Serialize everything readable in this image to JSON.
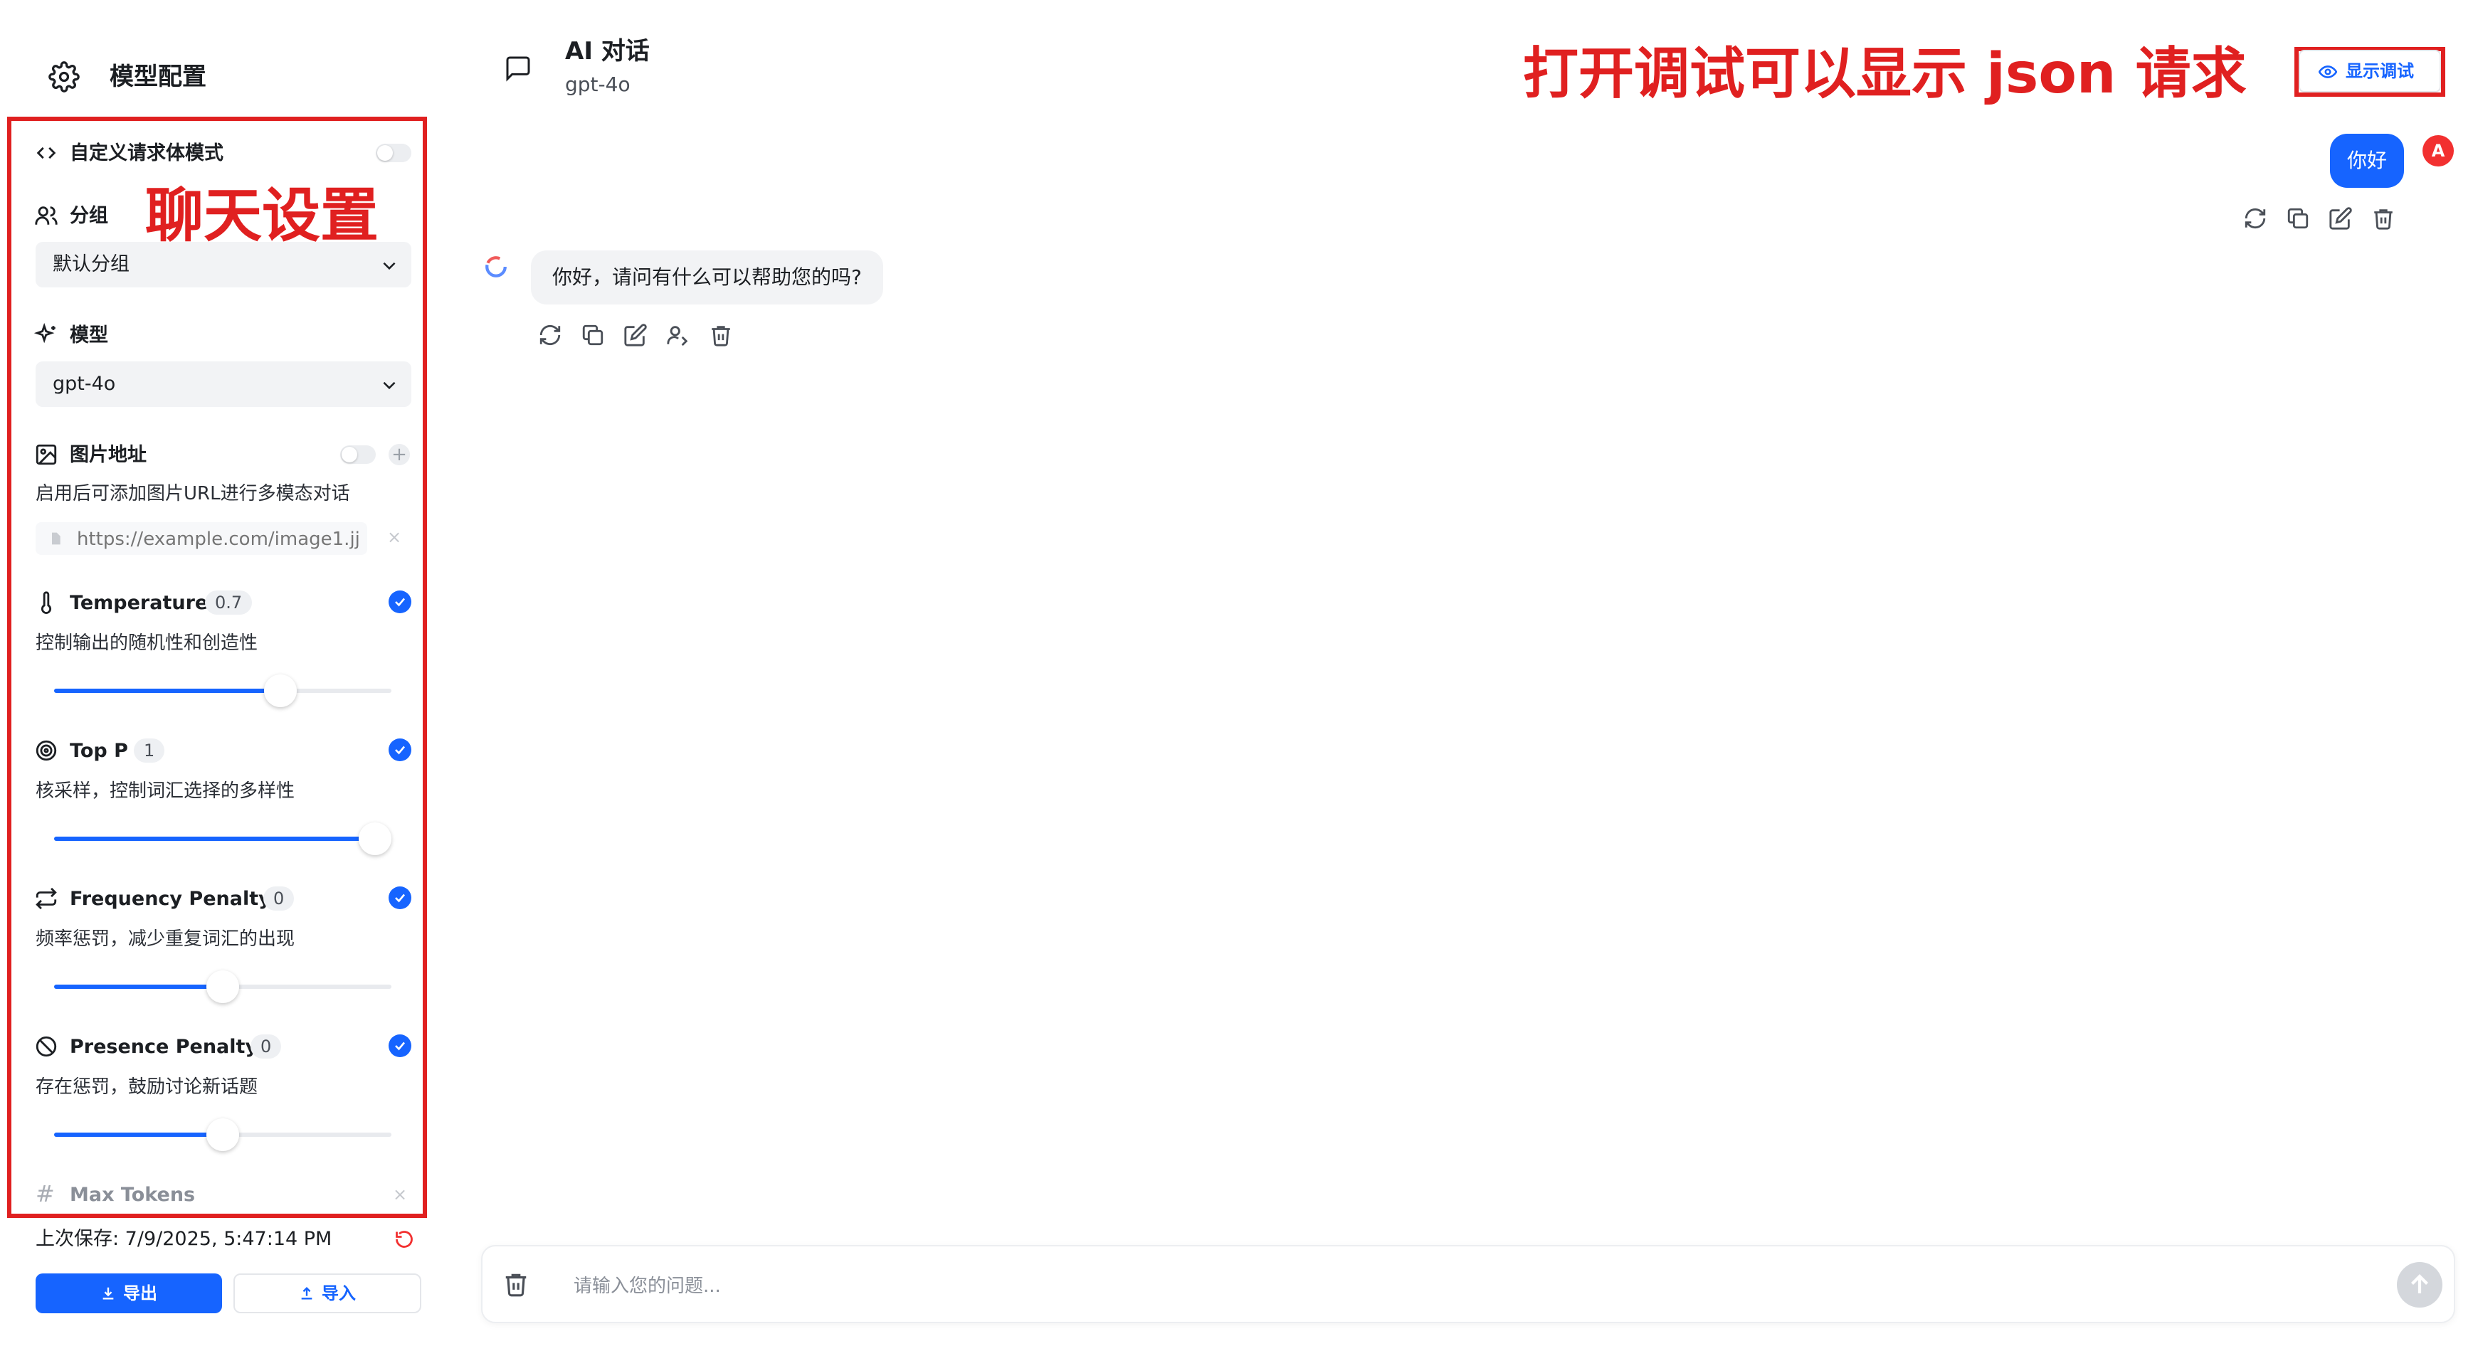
{
  "sidebar": {
    "title": "模型配置",
    "custom_body_mode": {
      "label": "自定义请求体模式",
      "enabled": false
    },
    "group": {
      "label": "分组",
      "value": "默认分组"
    },
    "model": {
      "label": "模型",
      "value": "gpt-4o"
    },
    "image_url": {
      "label": "图片地址",
      "enabled": false,
      "description": "启用后可添加图片URL进行多模态对话",
      "placeholder": "https://example.com/image1.jj"
    },
    "temperature": {
      "label": "Temperature",
      "value": "0.7",
      "description": "控制输出的随机性和创造性",
      "enabled": true,
      "level": 0.67
    },
    "top_p": {
      "label": "Top P",
      "value": "1",
      "description": "核采样，控制词汇选择的多样性",
      "enabled": true,
      "level": 1.0
    },
    "frequency_penalty": {
      "label": "Frequency Penalty",
      "value": "0",
      "description": "频率惩罚，减少重复词汇的出现",
      "enabled": true,
      "level": 0.5
    },
    "presence_penalty": {
      "label": "Presence Penalty",
      "value": "0",
      "description": "存在惩罚，鼓励讨论新话题",
      "enabled": true,
      "level": 0.5
    },
    "max_tokens": {
      "label": "Max Tokens"
    },
    "last_saved": "上次保存: 7/9/2025, 5:47:14 PM",
    "export_label": "导出",
    "import_label": "导入"
  },
  "chat": {
    "title": "AI 对话",
    "model": "gpt-4o",
    "debug_button": "显示调试",
    "user_avatar": "A",
    "messages": [
      {
        "role": "user",
        "text": "你好"
      },
      {
        "role": "assistant",
        "text": "你好，请问有什么可以帮助您的吗?"
      }
    ],
    "input_placeholder": "请输入您的问题..."
  },
  "annotations": {
    "sidebar_note": "聊天设置",
    "debug_note": "打开调试可以显示 json 请求"
  },
  "colors": {
    "accent": "#1664ff",
    "annotation": "#e02020"
  }
}
